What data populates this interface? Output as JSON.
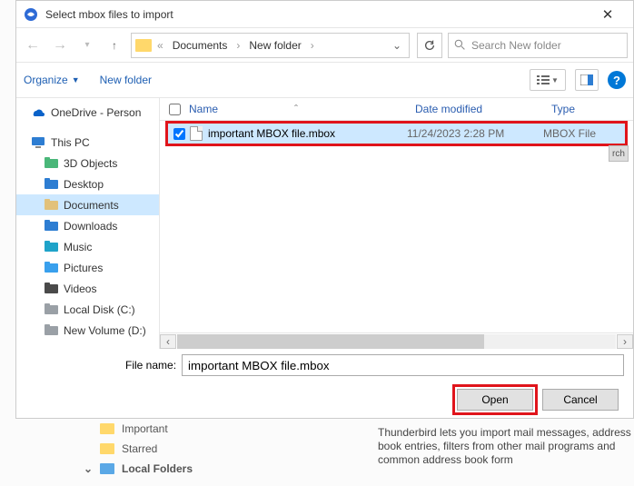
{
  "titlebar": {
    "title": "Select mbox files to import"
  },
  "nav": {
    "crumbs": [
      "Documents",
      "New folder"
    ],
    "search_placeholder": "Search New folder"
  },
  "toolbar": {
    "organize": "Organize",
    "new_folder": "New folder"
  },
  "headers": {
    "name": "Name",
    "date": "Date modified",
    "type": "Type"
  },
  "tree": {
    "onedrive": "OneDrive - Person",
    "thispc": "This PC",
    "items": [
      {
        "label": "3D Objects",
        "color": "#4ab779"
      },
      {
        "label": "Desktop",
        "color": "#2d7dd2"
      },
      {
        "label": "Documents",
        "color": "#e2c17a",
        "selected": true
      },
      {
        "label": "Downloads",
        "color": "#2d7dd2"
      },
      {
        "label": "Music",
        "color": "#1fa3c9"
      },
      {
        "label": "Pictures",
        "color": "#39a0ed"
      },
      {
        "label": "Videos",
        "color": "#4a4a4a"
      },
      {
        "label": "Local Disk (C:)",
        "color": "#9aa0a6"
      },
      {
        "label": "New Volume (D:)",
        "color": "#9aa0a6"
      }
    ]
  },
  "files": [
    {
      "name": "important MBOX file.mbox",
      "date": "11/24/2023 2:28 PM",
      "type": "MBOX File",
      "checked": true
    }
  ],
  "filename": {
    "label": "File name:",
    "value": "important MBOX file.mbox"
  },
  "buttons": {
    "open": "Open",
    "cancel": "Cancel"
  },
  "background": {
    "items": [
      "Important",
      "Starred",
      "Local Folders"
    ],
    "text": "Thunderbird lets you import mail messages, address book entries, filters from other mail programs and common address book form"
  }
}
